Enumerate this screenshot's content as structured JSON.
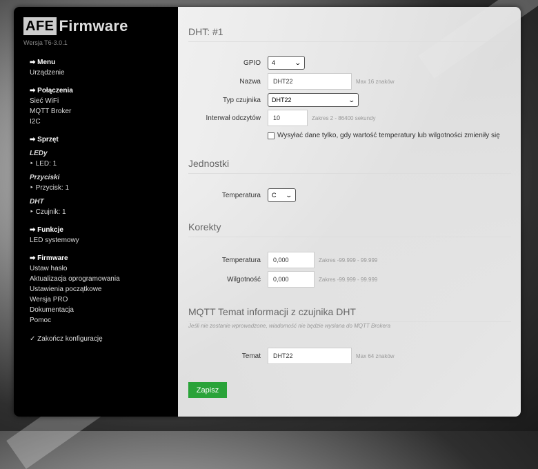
{
  "brand": {
    "logo_afe": "AFE",
    "logo_firmware": "Firmware",
    "version": "Wersja T6-3.0.1"
  },
  "sidebar": {
    "menu_head": "➡ Menu",
    "menu_items": [
      "Urządzenie"
    ],
    "conn_head": "➡ Połączenia",
    "conn_items": [
      "Sieć WiFi",
      "MQTT Broker",
      "I2C"
    ],
    "hw_head": "➡ Sprzęt",
    "hw_leds_label": "LEDy",
    "hw_leds_item": "‣ LED: 1",
    "hw_btn_label": "Przyciski",
    "hw_btn_item": "‣ Przycisk: 1",
    "hw_dht_label": "DHT",
    "hw_dht_item": "‣ Czujnik: 1",
    "func_head": "➡ Funkcje",
    "func_items": [
      "LED systemowy"
    ],
    "fw_head": "➡ Firmware",
    "fw_items": [
      "Ustaw hasło",
      "Aktualizacja oprogramowania",
      "Ustawienia początkowe",
      "Wersja PRO",
      "Dokumentacja",
      "Pomoc"
    ],
    "finish": "✓ Zakończ konfigurację"
  },
  "sections": {
    "dht": {
      "title": "DHT: #1",
      "gpio_label": "GPIO",
      "gpio_value": "4",
      "name_label": "Nazwa",
      "name_value": "DHT22",
      "name_hint": "Max 16 znaków",
      "type_label": "Typ czujnika",
      "type_value": "DHT22",
      "interval_label": "Interwał odczytów",
      "interval_value": "10",
      "interval_hint": "Zakres 2 - 86400 sekundy",
      "checkbox_label": "Wysyłać dane tylko, gdy wartość temperatury lub wilgotności zmieniły się"
    },
    "units": {
      "title": "Jednostki",
      "temp_label": "Temperatura",
      "temp_value": "C"
    },
    "corrections": {
      "title": "Korekty",
      "temp_label": "Temperatura",
      "temp_value": "0,000",
      "temp_hint": "Zakres -99.999 - 99.999",
      "hum_label": "Wilgotność",
      "hum_value": "0,000",
      "hum_hint": "Zakres -99.999 - 99.999"
    },
    "mqtt": {
      "title": "MQTT Temat informacji z czujnika DHT",
      "note": "Jeśli nie zostanie wprowadzone, wiadomość nie będzie wysłana do MQTT Brokera",
      "topic_label": "Temat",
      "topic_value": "DHT22",
      "topic_hint": "Max 64 znaków"
    }
  },
  "save_button": "Zapisz",
  "colors": {
    "accent": "#2aa339",
    "sidebar_bg": "#000000"
  }
}
